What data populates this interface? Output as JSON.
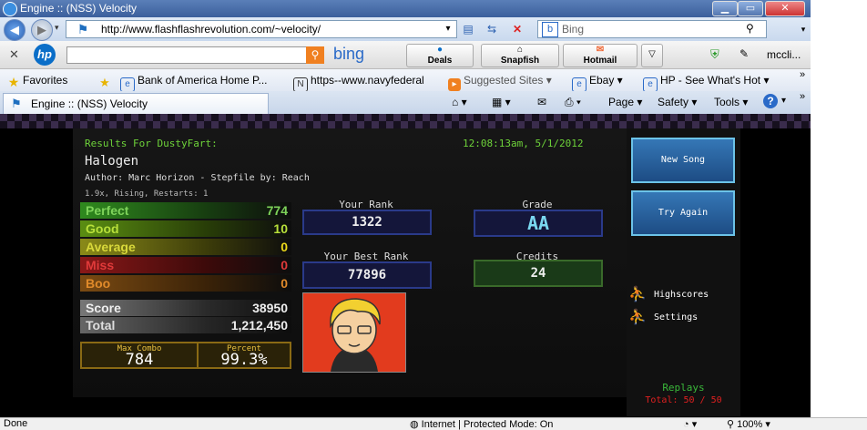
{
  "window": {
    "title": "Engine :: (NSS) Velocity"
  },
  "address": {
    "url": "http://www.flashflashrevolution.com/~velocity/",
    "search_placeholder": "Bing"
  },
  "hp_toolbar": {
    "search_engine": "bing",
    "buttons": [
      "Deals",
      "Snapfish",
      "Hotmail"
    ],
    "user": "mccli..."
  },
  "favorites": {
    "label": "Favorites",
    "items": [
      "Bank of America  Home  P...",
      "https--www.navyfederal",
      "Suggested Sites ▾",
      "Ebay ▾",
      "HP - See What's Hot ▾"
    ]
  },
  "tab": {
    "title": "Engine :: (NSS) Velocity"
  },
  "commands": {
    "page": "Page ▾",
    "safety": "Safety ▾",
    "tools": "Tools ▾",
    "help": "?"
  },
  "game": {
    "results_for": "Results For DustyFart:",
    "timestamp": "12:08:13am, 5/1/2012",
    "song": "Halogen",
    "credits_line": "Author: Marc Horizon  -  Stepfile by: Reach",
    "mods": "1.9x, Rising, Restarts: 1",
    "judgements": [
      {
        "label": "Perfect",
        "value": "774",
        "color": "#2f8a1e"
      },
      {
        "label": "Good",
        "value": "10",
        "color": "#5a8e12"
      },
      {
        "label": "Average",
        "value": "0",
        "color": "#8a8a18"
      },
      {
        "label": "Miss",
        "value": "0",
        "color": "#8a1818"
      },
      {
        "label": "Boo",
        "value": "0",
        "color": "#7a4a12"
      }
    ],
    "score_label": "Score",
    "score": "38950",
    "total_label": "Total",
    "total": "1,212,450",
    "max_combo_label": "Max Combo",
    "max_combo": "784",
    "percent_label": "Percent",
    "percent": "99.3%",
    "your_rank_label": "Your Rank",
    "your_rank": "1322",
    "best_rank_label": "Your Best Rank",
    "best_rank": "77896",
    "grade_label": "Grade",
    "grade": "AA",
    "credits_label": "Credits",
    "credits": "24",
    "buttons": {
      "new_song": "New Song",
      "try_again": "Try Again"
    },
    "links": {
      "highscores": "Highscores",
      "settings": "Settings"
    },
    "replays_label": "Replays",
    "replays_total": "Total: 50 / 50"
  },
  "status": {
    "left": "Done",
    "zone": "Internet | Protected Mode: On",
    "zoom": "100%"
  },
  "colors": {
    "title_bar": "#3b5f9c",
    "game_bg": "#000000",
    "accent_green": "#6ed33a",
    "button_blue": "#3577b6"
  }
}
